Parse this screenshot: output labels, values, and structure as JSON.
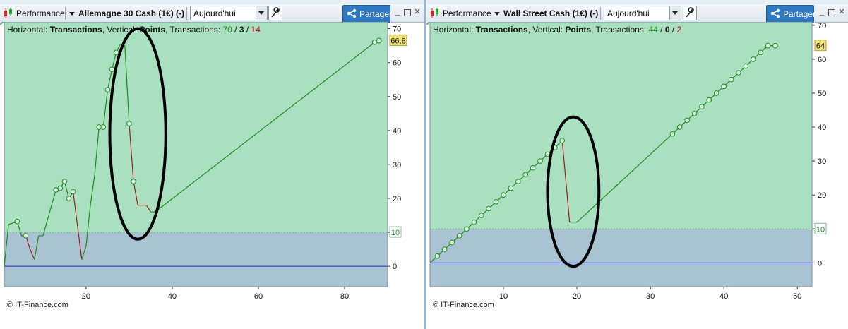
{
  "panels": [
    {
      "id": "p1",
      "app_label": "Performance",
      "title": "Allemagne 30 Cash (1€) (-)",
      "period": "Aujourd'hui",
      "share_label": "Partager",
      "info": {
        "h_label": "Horizontal: ",
        "h_value": "Transactions",
        "v_label": ", Vertical: ",
        "v_value": "Points",
        "t_label": ", Transactions: ",
        "total": "70",
        "sep1": " / ",
        "neutral": "3",
        "sep2": " / ",
        "losses": "14"
      },
      "watermark": "© IT-Finance.com",
      "current_value_label": "66,8",
      "threshold_label": "10"
    },
    {
      "id": "p2",
      "app_label": "Performance",
      "title": "Wall Street Cash (1€) (-)",
      "period": "Aujourd'hui",
      "share_label": "Partager",
      "info": {
        "h_label": "Horizontal: ",
        "h_value": "Transactions",
        "v_label": ", Vertical: ",
        "v_value": "Points",
        "t_label": ", Transactions: ",
        "total": "44",
        "sep1": " / ",
        "neutral": "0",
        "sep2": " / ",
        "losses": "2"
      },
      "watermark": "© IT-Finance.com",
      "current_value_label": "64",
      "threshold_label": "10"
    }
  ],
  "colors": {
    "gain_line": "#1f8a1f",
    "loss_line": "#9b1c1c",
    "zone_above": "#a8e0c0",
    "zone_below": "#a9c3d3",
    "zero_line": "#2222cc",
    "highlight_ellipse": "#000000",
    "value_badge": "#f0e27a",
    "threshold_badge_text": "#2b8a2b",
    "gain_count": "#1a8a1a",
    "loss_count": "#c01818",
    "share_button": "#2f78c4"
  },
  "chart_data": [
    {
      "type": "line",
      "title": "Allemagne 30 Cash (1€) (-)",
      "xlabel": "Transactions",
      "ylabel": "Points",
      "xlim": [
        1,
        90
      ],
      "ylim": [
        -6,
        72
      ],
      "x_ticks": [
        20,
        40,
        60,
        80
      ],
      "y_ticks": [
        0,
        10,
        20,
        30,
        40,
        50,
        60,
        70
      ],
      "threshold": 10,
      "zero_line": 0,
      "grid": false,
      "series": [
        {
          "x": [
            1,
            2,
            4,
            5,
            6,
            7,
            8,
            9,
            10,
            11,
            12,
            13,
            14,
            15,
            16,
            17,
            18,
            19,
            20,
            21,
            22,
            23,
            24,
            25,
            26,
            27,
            28,
            29,
            30,
            31,
            32,
            33,
            34,
            35,
            36,
            87,
            88
          ],
          "y": [
            0,
            12.3,
            13.2,
            9,
            9,
            5,
            2,
            9,
            9,
            13.5,
            18,
            22.5,
            23,
            25,
            20,
            22,
            12,
            2,
            6,
            18,
            27,
            41,
            41,
            52,
            58,
            63,
            65.5,
            65,
            42,
            25,
            18,
            18,
            18,
            16,
            16,
            66,
            66.5
          ],
          "markers": [
            2,
            4,
            11,
            12,
            13,
            14,
            15,
            21,
            22,
            23,
            24,
            25,
            28,
            29,
            35,
            36,
            37
          ],
          "loss_segments": [
            [
              3,
              4
            ],
            [
              4,
              5
            ],
            [
              5,
              6
            ],
            [
              14,
              15
            ],
            [
              15,
              16
            ],
            [
              16,
              17
            ],
            [
              28,
              29
            ],
            [
              29,
              30
            ],
            [
              30,
              31
            ],
            [
              31,
              32
            ],
            [
              32,
              33
            ]
          ]
        }
      ],
      "annotations": [
        {
          "type": "ellipse",
          "cx": 32,
          "cy": 39,
          "rx": 6.5,
          "ry": 31
        }
      ]
    },
    {
      "type": "line",
      "title": "Wall Street Cash (1€) (-)",
      "xlabel": "Transactions",
      "ylabel": "Points",
      "xlim": [
        0,
        52
      ],
      "ylim": [
        -7,
        71
      ],
      "x_ticks": [
        10,
        20,
        30,
        40,
        50
      ],
      "y_ticks": [
        0,
        10,
        20,
        30,
        40,
        50,
        60,
        70
      ],
      "threshold": 10,
      "zero_line": 0,
      "grid": false,
      "series": [
        {
          "x": [
            0,
            1,
            2,
            3,
            4,
            5,
            6,
            7,
            8,
            9,
            10,
            11,
            12,
            13,
            14,
            15,
            16,
            17,
            18,
            19,
            20,
            33,
            34,
            35,
            36,
            37,
            38,
            39,
            40,
            41,
            42,
            43,
            44,
            45,
            46,
            47
          ],
          "y": [
            0,
            2,
            4,
            6,
            8,
            10,
            12,
            14,
            16,
            18,
            20,
            22,
            24,
            26,
            28,
            30,
            32,
            34,
            36,
            12,
            12,
            38,
            40,
            42,
            44,
            46,
            48,
            50,
            52,
            54,
            56,
            58,
            60,
            62,
            64,
            64
          ],
          "markers": [
            1,
            2,
            3,
            4,
            5,
            6,
            7,
            8,
            9,
            10,
            11,
            12,
            13,
            14,
            15,
            16,
            17,
            18,
            21,
            22,
            23,
            24,
            25,
            26,
            27,
            28,
            29,
            30,
            31,
            32,
            33,
            34,
            35,
            36
          ],
          "loss_segments": [
            [
              18,
              19
            ]
          ]
        }
      ],
      "annotations": [
        {
          "type": "ellipse",
          "cx": 19.5,
          "cy": 21,
          "rx": 3.5,
          "ry": 22
        }
      ]
    }
  ]
}
